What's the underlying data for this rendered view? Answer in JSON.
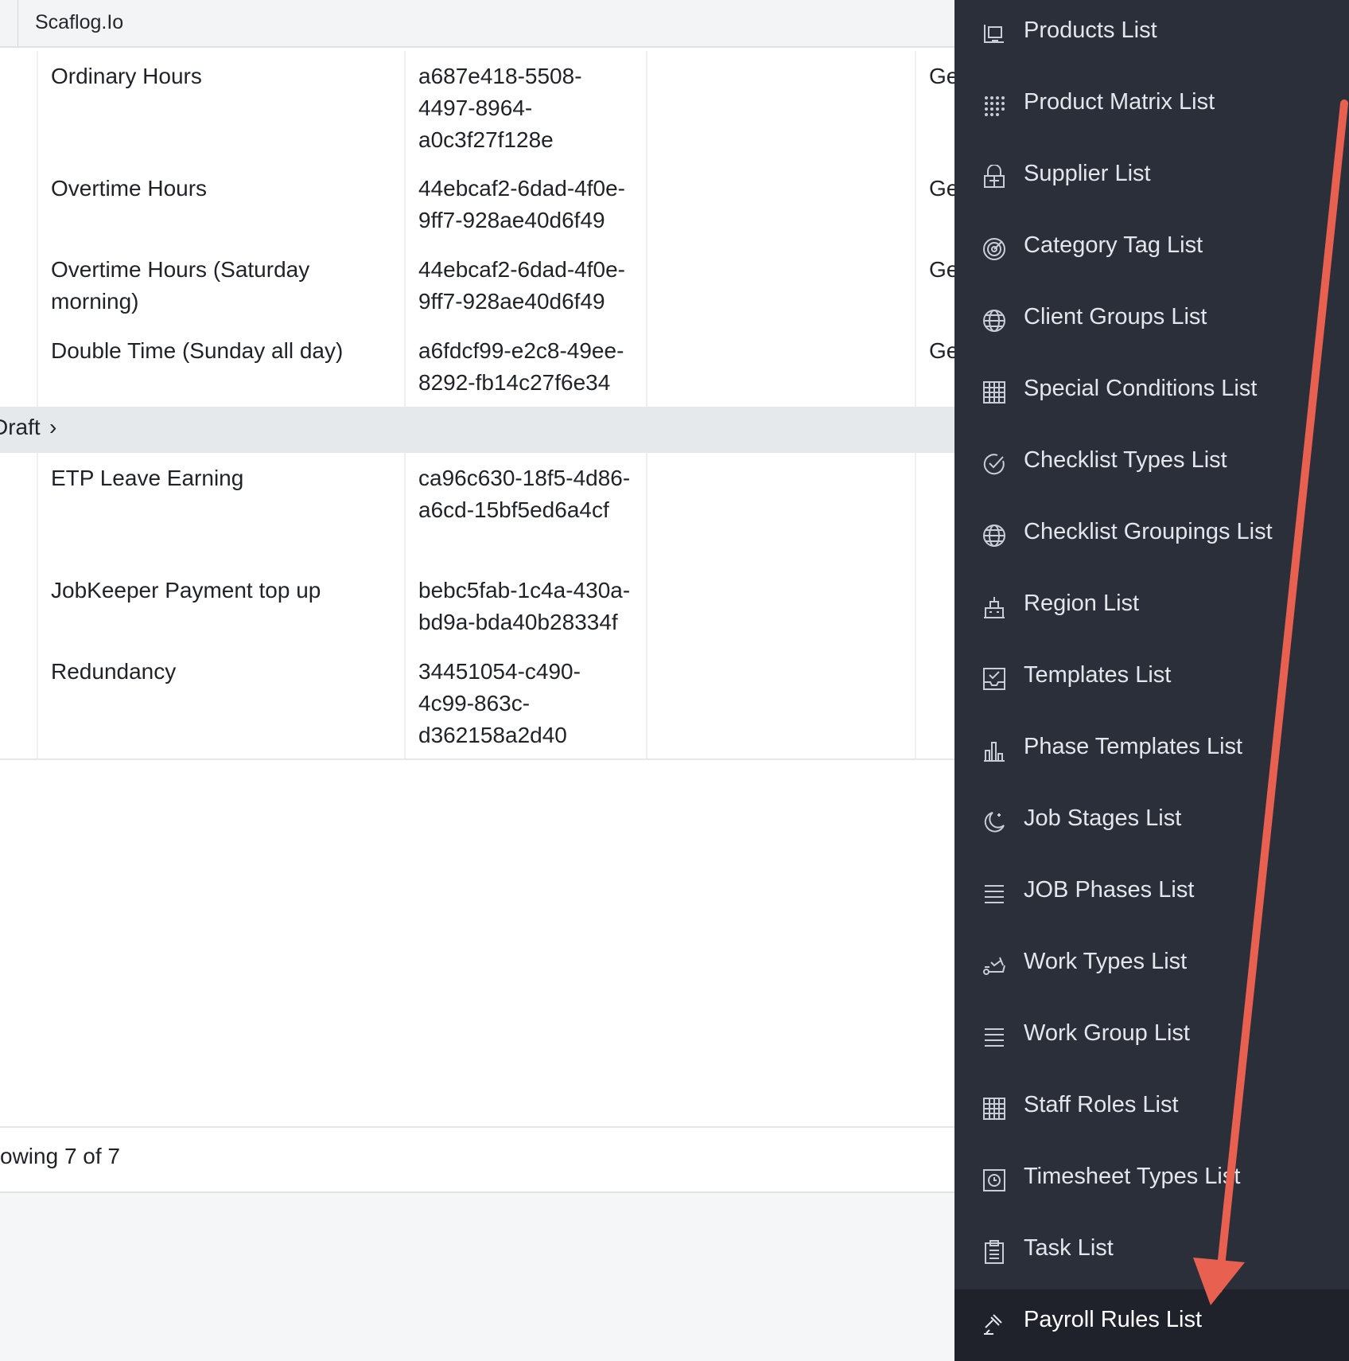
{
  "header": {
    "breadcrumb": "Scaflog.Io"
  },
  "rows_top": [
    {
      "name": "Ordinary Hours",
      "id": "a687e418-5508-4497-8964-a0c3f27f128e",
      "extra": "Ge"
    },
    {
      "name": "Overtime Hours",
      "id": "44ebcaf2-6dad-4f0e-9ff7-928ae40d6f49",
      "extra": "Ge"
    },
    {
      "name": "Overtime Hours (Saturday morning)",
      "id": "44ebcaf2-6dad-4f0e-9ff7-928ae40d6f49",
      "extra": "Ge"
    },
    {
      "name": "Double Time (Sunday all day)",
      "id": "a6fdcf99-e2c8-49ee-8292-fb14c27f6e34",
      "extra": "Ge"
    }
  ],
  "group": {
    "label": "Draft",
    "chevron": "›"
  },
  "rows_bottom": [
    {
      "name": "ETP Leave Earning",
      "id": "ca96c630-18f5-4d86-a6cd-15bf5ed6a4cf"
    },
    {
      "name": "JobKeeper Payment top up",
      "id": "bebc5fab-1c4a-430a-bd9a-bda40b28334f"
    },
    {
      "name": "Redundancy",
      "id": "34451054-c490-4c99-863c-d362158a2d40"
    }
  ],
  "footer": {
    "text": "owing 7 of 7"
  },
  "sidebar": {
    "items": [
      {
        "label": "Products List",
        "icon": "products-icon"
      },
      {
        "label": "Product Matrix List",
        "icon": "matrix-icon"
      },
      {
        "label": "Supplier List",
        "icon": "supplier-icon"
      },
      {
        "label": "Category Tag List",
        "icon": "target-icon"
      },
      {
        "label": "Client Groups List",
        "icon": "globe-icon"
      },
      {
        "label": "Special Conditions List",
        "icon": "grid-icon"
      },
      {
        "label": "Checklist Types List",
        "icon": "check-circle-icon"
      },
      {
        "label": "Checklist Groupings List",
        "icon": "globe-icon"
      },
      {
        "label": "Region List",
        "icon": "building-icon"
      },
      {
        "label": "Templates List",
        "icon": "inbox-check-icon"
      },
      {
        "label": "Phase Templates List",
        "icon": "bar-chart-icon"
      },
      {
        "label": "Job Stages List",
        "icon": "moon-icon"
      },
      {
        "label": "JOB Phases List",
        "icon": "lines-icon"
      },
      {
        "label": "Work Types List",
        "icon": "treadmill-icon"
      },
      {
        "label": "Work Group List",
        "icon": "lines-icon"
      },
      {
        "label": "Staff Roles List",
        "icon": "grid-icon"
      },
      {
        "label": "Timesheet Types List",
        "icon": "clock-icon"
      },
      {
        "label": "Task List",
        "icon": "clipboard-icon"
      },
      {
        "label": "Payroll Rules List",
        "icon": "gavel-icon"
      }
    ]
  },
  "colors": {
    "sidebar_bg": "#2b2f39",
    "sidebar_active": "#1f222a",
    "annotation_arrow": "#e8604f",
    "group_bg": "#e6e9ec"
  }
}
